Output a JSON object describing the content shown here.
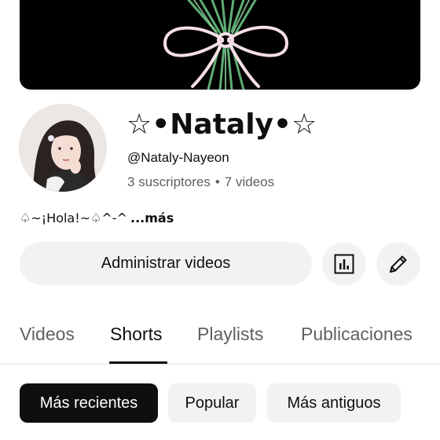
{
  "channel": {
    "name": "☆•Nataly•☆",
    "handle": "@Nataly-Nayeon",
    "subscribers": "3 suscriptores",
    "separator": "•",
    "videos": "7 videos",
    "description": "♤~¡Hola!~♤^-^",
    "more_label": "...más"
  },
  "actions": {
    "manage_label": "Administrar videos",
    "stats_icon": "analytics-icon",
    "edit_icon": "pencil-icon"
  },
  "tabs": [
    {
      "label": "Videos",
      "active": false
    },
    {
      "label": "Shorts",
      "active": true
    },
    {
      "label": "Playlists",
      "active": false
    },
    {
      "label": "Publicaciones",
      "active": false
    }
  ],
  "filters": [
    {
      "label": "Más recientes",
      "active": true
    },
    {
      "label": "Popular",
      "active": false
    },
    {
      "label": "Más antiguos",
      "active": false
    }
  ],
  "colors": {
    "background": "#ffffff",
    "chip_bg": "#f2f2f2",
    "active_chip_bg": "#0f0f0f",
    "secondary_text": "#606060"
  }
}
